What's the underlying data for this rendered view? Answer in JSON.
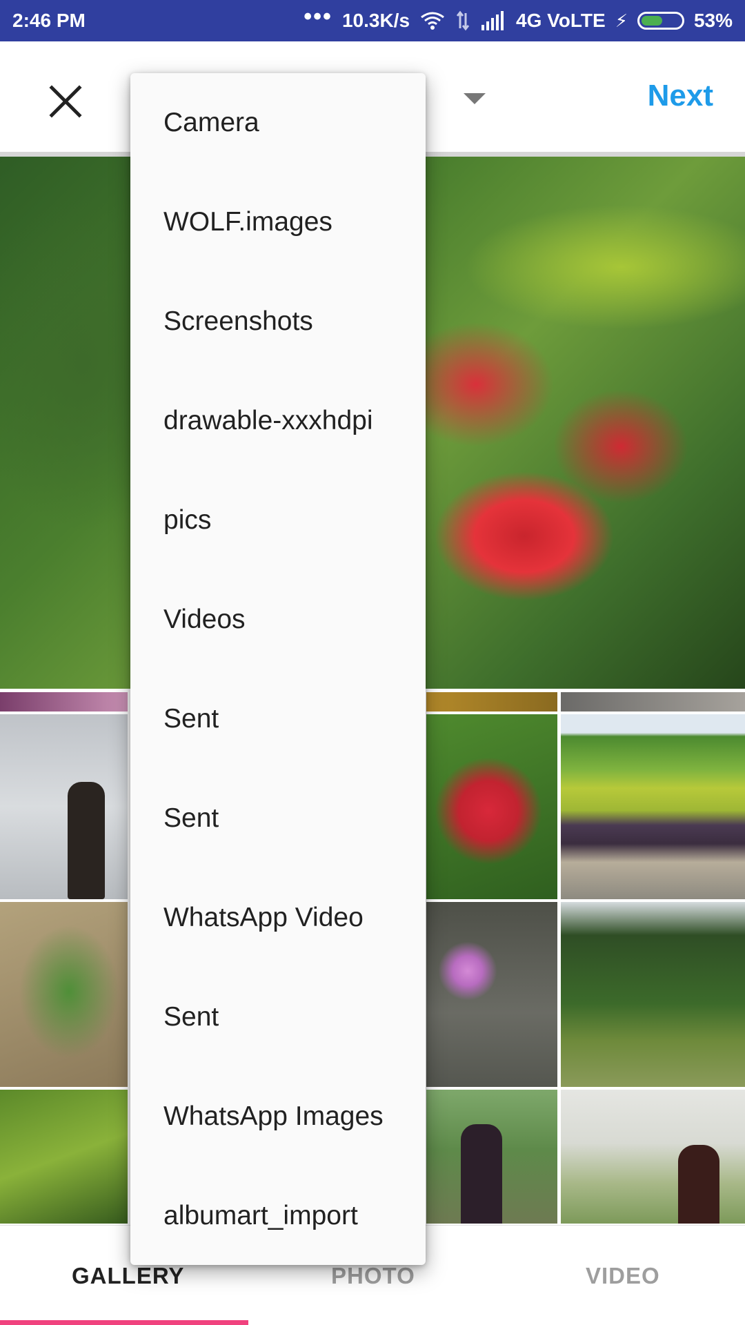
{
  "status_bar": {
    "time": "2:46 PM",
    "more": "•••",
    "network_speed": "10.3K/s",
    "network_type": "4G VoLTE",
    "battery": "53%",
    "battery_level": 0.53,
    "battery_color": "#4caf50",
    "background": "#303f9f"
  },
  "header": {
    "close_icon": "close-icon",
    "next_label": "Next",
    "accent": "#1e9be9"
  },
  "album_dropdown": {
    "items": [
      "Camera",
      "WOLF.images",
      "Screenshots",
      "drawable-xxxhdpi",
      "pics",
      "Videos",
      "Sent",
      "Sent",
      "WhatsApp Video",
      "Sent",
      "WhatsApp Images",
      "albumart_import"
    ]
  },
  "tabs": [
    {
      "label": "GALLERY",
      "selected": true
    },
    {
      "label": "PHOTO",
      "selected": false
    },
    {
      "label": "VIDEO",
      "selected": false
    }
  ],
  "tab_indicator_color": "#f0427e"
}
